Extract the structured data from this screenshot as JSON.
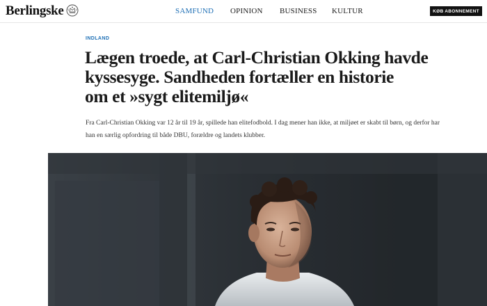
{
  "header": {
    "logo": "Berlingske",
    "nav": [
      {
        "label": "SAMFUND",
        "active": true
      },
      {
        "label": "OPINION",
        "active": false
      },
      {
        "label": "BUSINESS",
        "active": false
      },
      {
        "label": "KULTUR",
        "active": false
      }
    ],
    "buy_button": "KØB ABONNEMENT"
  },
  "article": {
    "category": "INDLAND",
    "headline_lines": [
      "Lægen troede, at Carl-Christian Okking havde",
      "kyssesyge. Sandheden fortæller en historie",
      "om et »sygt elitemiljø«"
    ],
    "lede_lines": [
      "Fra Carl-Christian Okking var 12 år til 19 år, spillede han elitefodbold. I dag mener han ikke, at miljøet er skabt til børn, og derfor har",
      "han en særlig opfordring til både DBU, forældre og landets klubber."
    ]
  },
  "colors": {
    "accent": "#1e6fb5",
    "text": "#1a1a1a",
    "button_bg": "#111111"
  },
  "icons": {
    "crest": "royal-crest-icon"
  }
}
